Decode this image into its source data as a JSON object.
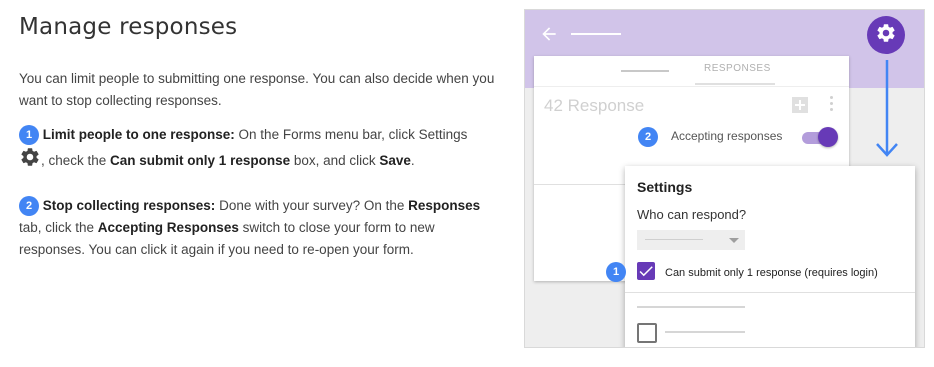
{
  "page": {
    "title": "Manage responses",
    "intro": "You can limit people to submitting one response. You can also decide when you want to stop collecting responses.",
    "step1": {
      "number": "1",
      "bold_lead": "Limit people to one response:",
      "text_a": " On the Forms menu bar, click Settings",
      "text_b": ", check the ",
      "bold_option": "Can submit only 1 response",
      "text_c": " box, and click ",
      "bold_save": "Save",
      "text_d": "."
    },
    "step2": {
      "number": "2",
      "bold_lead": "Stop collecting responses:",
      "text_a": " Done with your survey? On the ",
      "bold_tab": "Responses",
      "text_b": " tab, click the ",
      "bold_switch": "Accepting Responses",
      "text_c": " switch to close your form to new responses. You can click it again if you need to re-open your form."
    }
  },
  "screenshot": {
    "tab_label": "RESPONSES",
    "response_count": "42 Response",
    "accepting_label": "Accepting responses",
    "accepting_on": true,
    "badge_1": "1",
    "badge_2": "2",
    "settings": {
      "title": "Settings",
      "who_can_respond": "Who can respond?",
      "option_checked_label": "Can submit only 1 response (requires login)",
      "option_checked": true
    },
    "colors": {
      "header": "#d1c4e9",
      "accent": "#673ab7",
      "badge": "#4285f4",
      "arrow": "#4285f4"
    },
    "icons": [
      "back-arrow-icon",
      "gear-icon",
      "sheets-icon",
      "more-vert-icon",
      "arrow-down-icon",
      "check-icon"
    ]
  }
}
